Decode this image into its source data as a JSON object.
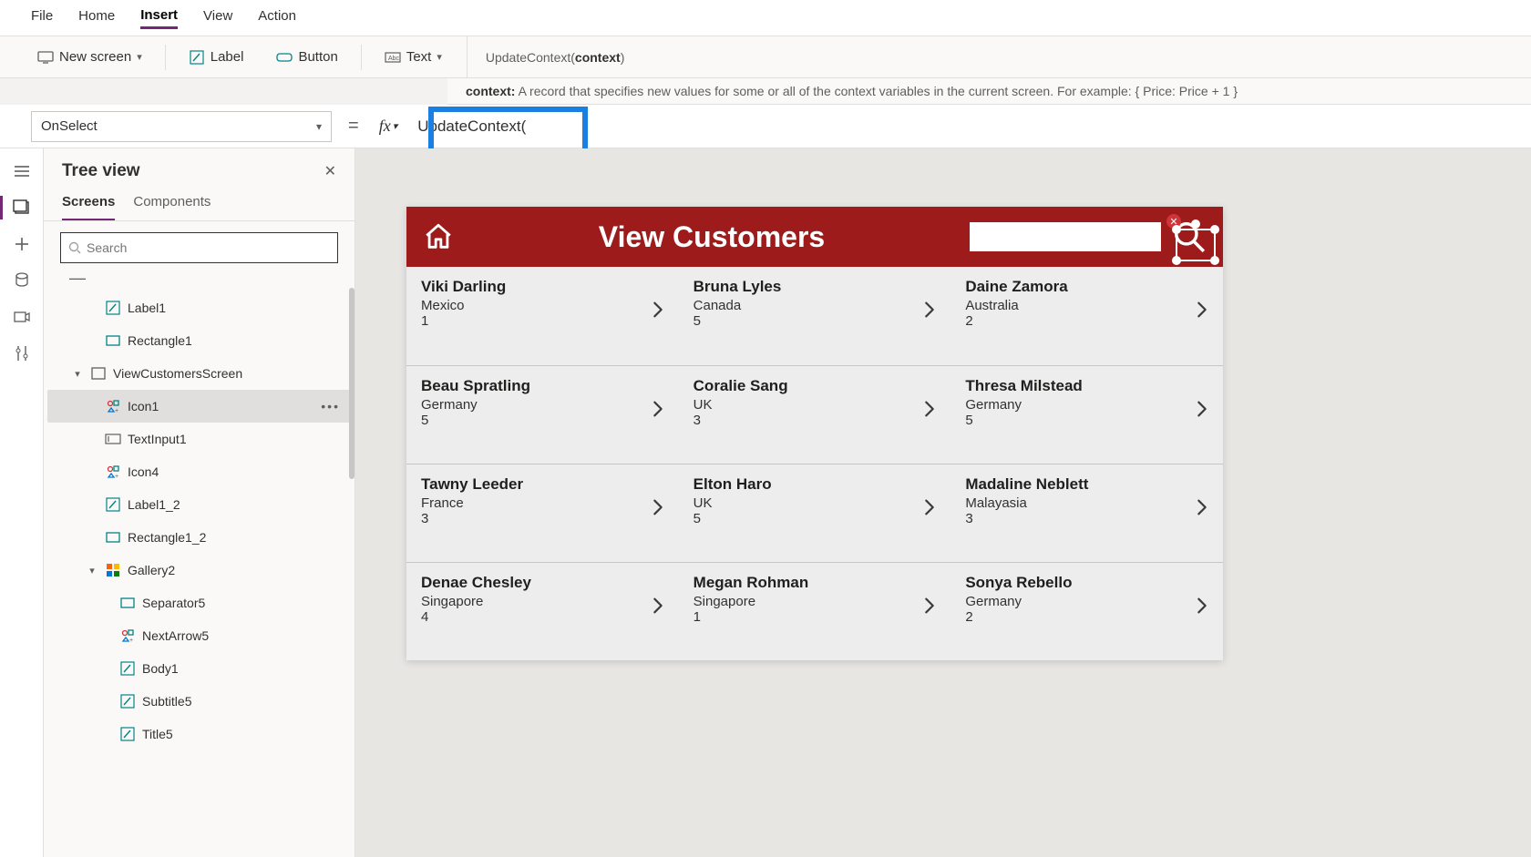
{
  "menubar": {
    "items": [
      "File",
      "Home",
      "Insert",
      "View",
      "Action"
    ],
    "active": 2
  },
  "ribbon": {
    "new_screen": "New screen",
    "label": "Label",
    "button": "Button",
    "text": "Text"
  },
  "signature": {
    "line1_prefix": "UpdateContext(",
    "line1_bold": "context",
    "line1_suffix": ")",
    "help_bold": "context:",
    "help_text": " A record that specifies new values for some or all of the context variables in the current screen. For example: { Price: Price + 1 }"
  },
  "fxrow": {
    "property": "OnSelect",
    "formula": "UpdateContext("
  },
  "treeview": {
    "title": "Tree view",
    "tabs": [
      "Screens",
      "Components"
    ],
    "active_tab": 0,
    "search_placeholder": "Search",
    "nodes": [
      {
        "label": "Label1",
        "indent": 2,
        "icon": "label"
      },
      {
        "label": "Rectangle1",
        "indent": 2,
        "icon": "rect"
      },
      {
        "label": "ViewCustomersScreen",
        "indent": 1,
        "icon": "screen",
        "chevron": "down"
      },
      {
        "label": "Icon1",
        "indent": 2,
        "icon": "iconctl",
        "selected": true,
        "more": true
      },
      {
        "label": "TextInput1",
        "indent": 2,
        "icon": "textinput"
      },
      {
        "label": "Icon4",
        "indent": 2,
        "icon": "iconctl"
      },
      {
        "label": "Label1_2",
        "indent": 2,
        "icon": "label"
      },
      {
        "label": "Rectangle1_2",
        "indent": 2,
        "icon": "rect"
      },
      {
        "label": "Gallery2",
        "indent": 2,
        "icon": "gallery",
        "chevron": "down"
      },
      {
        "label": "Separator5",
        "indent": 3,
        "icon": "rect"
      },
      {
        "label": "NextArrow5",
        "indent": 3,
        "icon": "iconctl"
      },
      {
        "label": "Body1",
        "indent": 3,
        "icon": "label"
      },
      {
        "label": "Subtitle5",
        "indent": 3,
        "icon": "label"
      },
      {
        "label": "Title5",
        "indent": 3,
        "icon": "label"
      }
    ]
  },
  "app": {
    "title": "View Customers",
    "customers": [
      [
        {
          "name": "Viki  Darling",
          "country": "Mexico",
          "num": "1"
        },
        {
          "name": "Bruna  Lyles",
          "country": "Canada",
          "num": "5"
        },
        {
          "name": "Daine  Zamora",
          "country": "Australia",
          "num": "2"
        }
      ],
      [
        {
          "name": "Beau  Spratling",
          "country": "Germany",
          "num": "5"
        },
        {
          "name": "Coralie  Sang",
          "country": "UK",
          "num": "3"
        },
        {
          "name": "Thresa  Milstead",
          "country": "Germany",
          "num": "5"
        }
      ],
      [
        {
          "name": "Tawny  Leeder",
          "country": "France",
          "num": "3"
        },
        {
          "name": "Elton  Haro",
          "country": "UK",
          "num": "5"
        },
        {
          "name": "Madaline  Neblett",
          "country": "Malayasia",
          "num": "3"
        }
      ],
      [
        {
          "name": "Denae  Chesley",
          "country": "Singapore",
          "num": "4"
        },
        {
          "name": "Megan  Rohman",
          "country": "Singapore",
          "num": "1"
        },
        {
          "name": "Sonya  Rebello",
          "country": "Germany",
          "num": "2"
        }
      ]
    ]
  }
}
